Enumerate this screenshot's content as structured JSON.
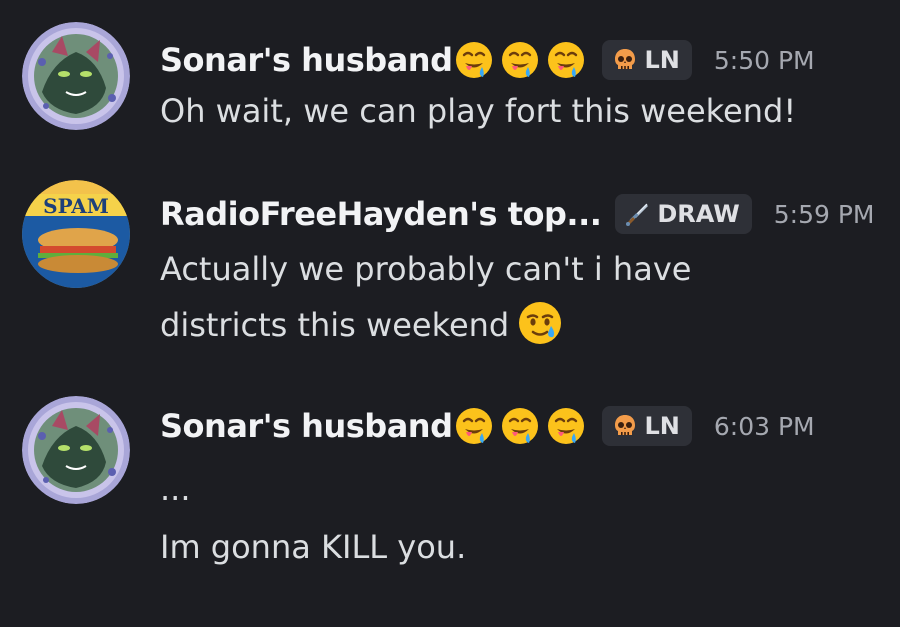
{
  "messages": [
    {
      "author": "Sonar's husband",
      "name_emojis": [
        "drooling-face",
        "drooling-face",
        "drooling-face"
      ],
      "tag": {
        "icon": "skull-icon",
        "label": "LN"
      },
      "time": "5:50 PM",
      "lines": [
        "Oh wait, we can play fort this weekend!"
      ],
      "avatar": "creature-avatar"
    },
    {
      "author": "RadioFreeHayden's top...",
      "name_emojis": [],
      "tag": {
        "icon": "sword-icon",
        "label": "DRAW"
      },
      "time": "5:59 PM",
      "lines": [
        "Actually we probably can't i have",
        "districts this weekend"
      ],
      "inline_emoji": "smiling-face-with-tear",
      "avatar": "spam-burger-avatar",
      "avatar_text": "SPAM"
    },
    {
      "author": "Sonar's husband",
      "name_emojis": [
        "drooling-face",
        "drooling-face",
        "drooling-face"
      ],
      "tag": {
        "icon": "skull-icon",
        "label": "LN"
      },
      "time": "6:03 PM",
      "lines": [
        "...",
        "Im gonna KILL you."
      ],
      "avatar": "creature-avatar"
    }
  ],
  "colors": {
    "background": "#1c1d22",
    "username": "#f2f3f5",
    "message_text": "#dbdee1",
    "timestamp": "#a5a8b0",
    "tag_background": "#2e3037"
  }
}
